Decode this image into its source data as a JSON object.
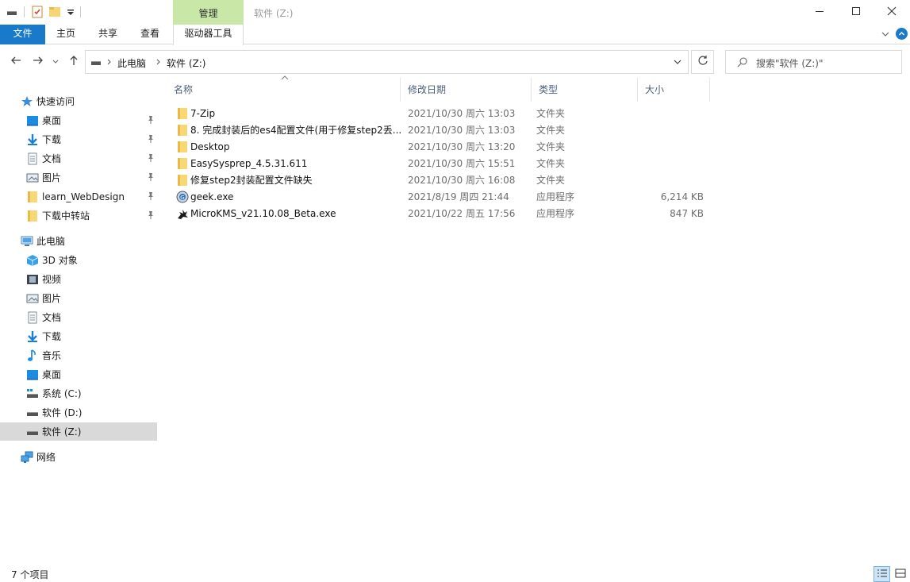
{
  "window": {
    "title": "软件 (Z:)",
    "context_tab_group": "管理",
    "minimize_icon": "minimize-icon",
    "maximize_icon": "maximize-icon",
    "close_icon": "close-icon"
  },
  "ribbon": {
    "tabs": [
      {
        "label": "文件"
      },
      {
        "label": "主页"
      },
      {
        "label": "共享"
      },
      {
        "label": "查看"
      },
      {
        "label": "驱动器工具"
      }
    ]
  },
  "address": {
    "path": [
      "此电脑",
      "软件 (Z:)"
    ],
    "search_placeholder": "搜索\"软件 (Z:)\""
  },
  "nav": {
    "quick_access": "快速访问",
    "quick_items": [
      {
        "label": "桌面",
        "icon": "desktop-icon"
      },
      {
        "label": "下载",
        "icon": "download-icon"
      },
      {
        "label": "文档",
        "icon": "document-icon"
      },
      {
        "label": "图片",
        "icon": "picture-icon"
      },
      {
        "label": "learn_WebDesign",
        "icon": "folder-icon"
      },
      {
        "label": "下载中转站",
        "icon": "folder-icon"
      }
    ],
    "this_pc": "此电脑",
    "pc_items": [
      {
        "label": "3D 对象",
        "icon": "3d-objects-icon"
      },
      {
        "label": "视频",
        "icon": "video-icon"
      },
      {
        "label": "图片",
        "icon": "picture-icon"
      },
      {
        "label": "文档",
        "icon": "document-icon"
      },
      {
        "label": "下载",
        "icon": "download-icon"
      },
      {
        "label": "音乐",
        "icon": "music-icon"
      },
      {
        "label": "桌面",
        "icon": "desktop-icon"
      },
      {
        "label": "系统 (C:)",
        "icon": "system-drive-icon"
      },
      {
        "label": "软件 (D:)",
        "icon": "drive-icon"
      },
      {
        "label": "软件 (Z:)",
        "icon": "drive-icon"
      }
    ],
    "network": "网络"
  },
  "columns": {
    "name": "名称",
    "date": "修改日期",
    "type": "类型",
    "size": "大小"
  },
  "files": [
    {
      "name": "7-Zip",
      "date": "2021/10/30 周六 13:03",
      "type": "文件夹",
      "size": "",
      "icon": "folder-icon"
    },
    {
      "name": "8. 完成封装后的es4配置文件(用于修复step2丢...",
      "date": "2021/10/30 周六 13:03",
      "type": "文件夹",
      "size": "",
      "icon": "folder-icon"
    },
    {
      "name": "Desktop",
      "date": "2021/10/30 周六 13:20",
      "type": "文件夹",
      "size": "",
      "icon": "folder-icon"
    },
    {
      "name": "EasySysprep_4.5.31.611",
      "date": "2021/10/30 周六 15:51",
      "type": "文件夹",
      "size": "",
      "icon": "folder-icon"
    },
    {
      "name": "修复step2封装配置文件缺失",
      "date": "2021/10/30 周六 16:08",
      "type": "文件夹",
      "size": "",
      "icon": "folder-icon"
    },
    {
      "name": "geek.exe",
      "date": "2021/8/19 周四 21:44",
      "type": "应用程序",
      "size": "6,214 KB",
      "icon": "geek-app-icon"
    },
    {
      "name": "MicroKMS_v21.10.08_Beta.exe",
      "date": "2021/10/22 周五 17:56",
      "type": "应用程序",
      "size": "847 KB",
      "icon": "microkms-app-icon"
    }
  ],
  "status": {
    "item_count": "7 个项目"
  }
}
